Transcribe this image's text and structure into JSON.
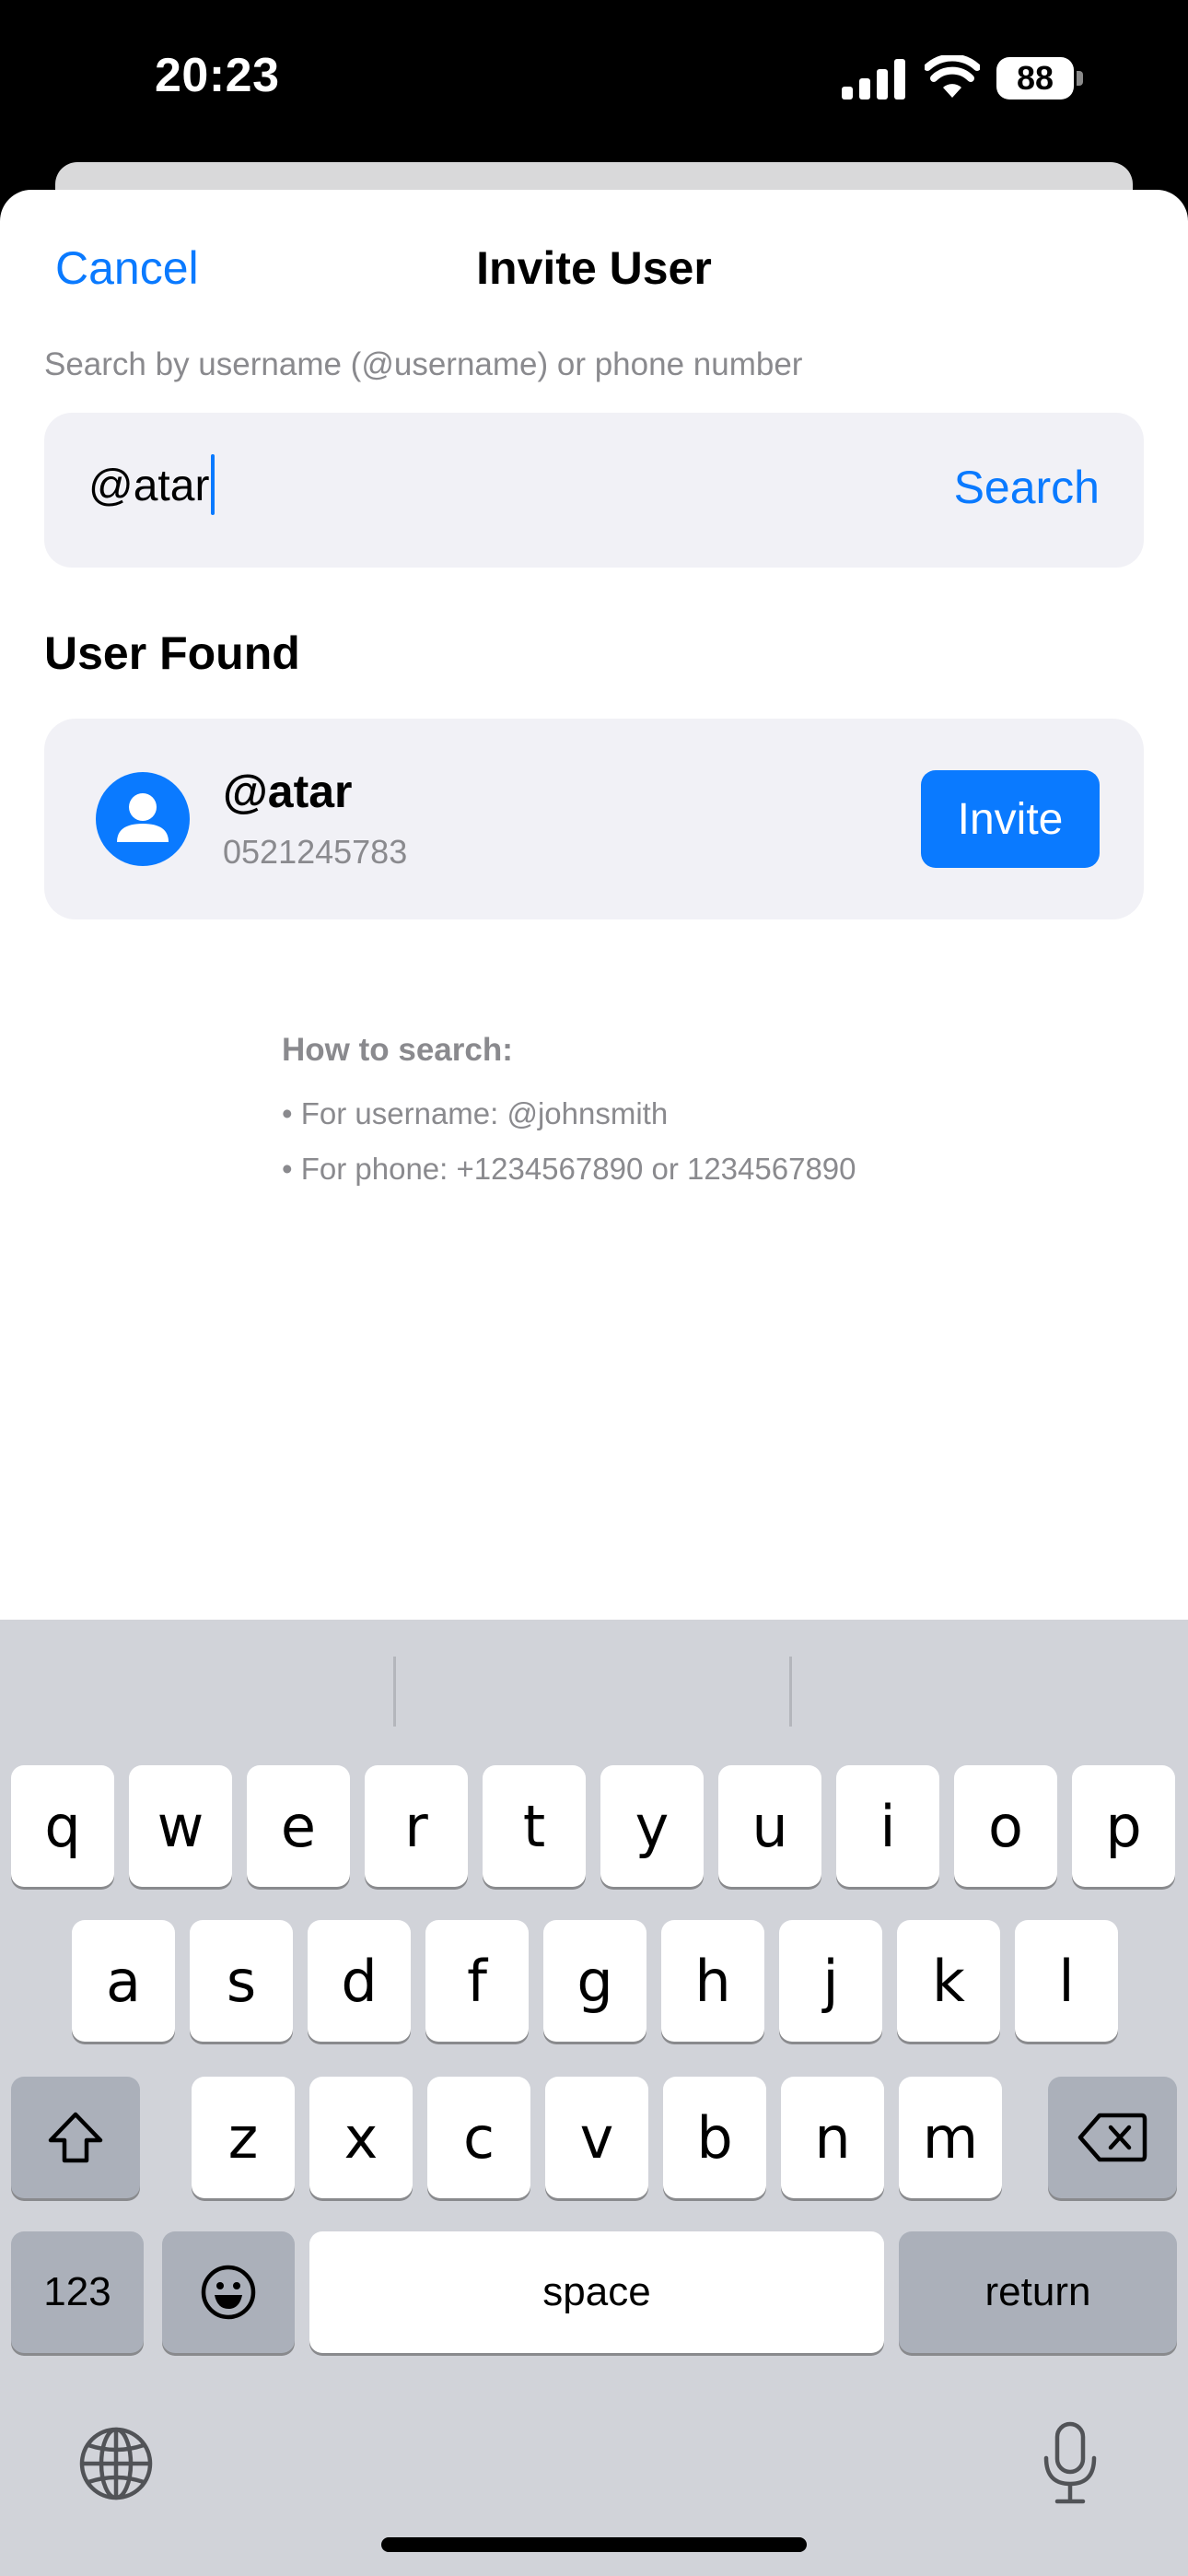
{
  "status": {
    "time": "20:23",
    "battery": "88",
    "icons": [
      "signal-icon",
      "wifi-icon",
      "battery-icon"
    ]
  },
  "sheet": {
    "cancel_label": "Cancel",
    "title": "Invite User",
    "search_hint": "Search by username (@username) or phone number",
    "search_value": "@atar",
    "search_label": "Search",
    "section_title": "User Found",
    "user": {
      "name": "@atar",
      "phone": "0521245783",
      "invite_label": "Invite",
      "avatar_icon": "person-icon"
    },
    "help": {
      "title": "How to search:",
      "lines": [
        "• For username: @johnsmith",
        "• For phone: +1234567890 or 1234567890"
      ]
    }
  },
  "keyboard": {
    "row1": [
      "q",
      "w",
      "e",
      "r",
      "t",
      "y",
      "u",
      "i",
      "o",
      "p"
    ],
    "row2": [
      "a",
      "s",
      "d",
      "f",
      "g",
      "h",
      "j",
      "k",
      "l"
    ],
    "row3": [
      "z",
      "x",
      "c",
      "v",
      "b",
      "n",
      "m"
    ],
    "numbers_label": "123",
    "space_label": "space",
    "return_label": "return",
    "icons": [
      "shift-icon",
      "delete-icon",
      "emoji-icon",
      "globe-icon",
      "microphone-icon"
    ]
  },
  "colors": {
    "accent": "#0a7aff",
    "keyboard_bg": "#d1d3d9",
    "field_bg": "#f1f1f6",
    "secondary_text": "#8a8a8e"
  }
}
